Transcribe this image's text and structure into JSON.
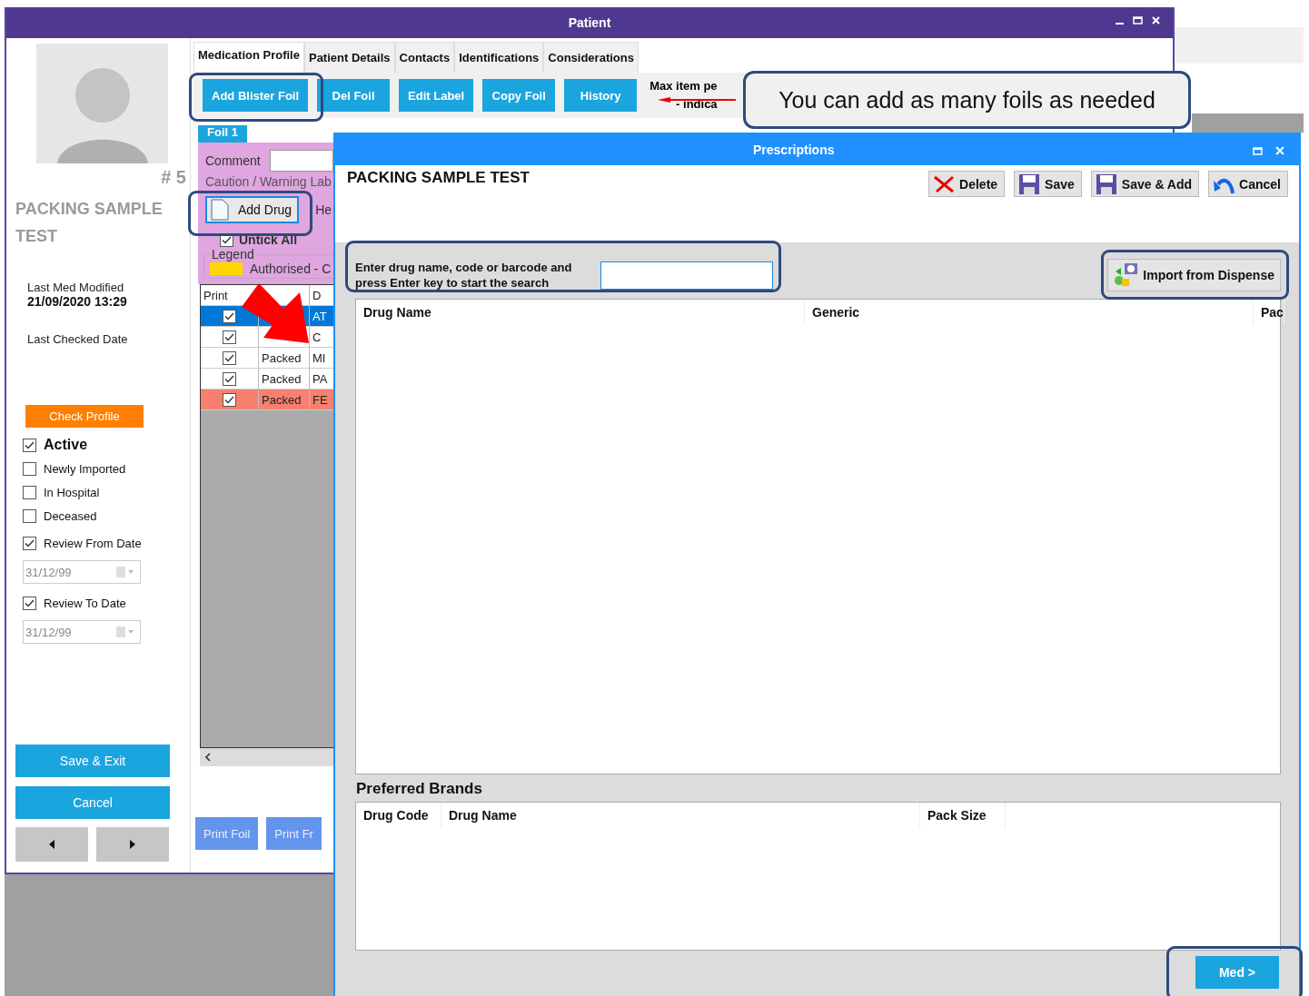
{
  "patient_window": {
    "title": "Patient",
    "profile": {
      "number": "# 5",
      "name": "PACKING SAMPLE TEST",
      "last_med_modified_label": "Last Med Modified",
      "last_med_modified": "21/09/2020 13:29",
      "last_checked_label": "Last Checked Date",
      "check_profile": "Check Profile",
      "flags": [
        {
          "label": "Active",
          "checked": true,
          "emphasis": true
        },
        {
          "label": "Newly Imported",
          "checked": false,
          "emphasis": false
        },
        {
          "label": "In Hospital",
          "checked": false,
          "emphasis": false
        },
        {
          "label": "Deceased",
          "checked": false,
          "emphasis": false
        },
        {
          "label": "Review From Date",
          "checked": true,
          "emphasis": false,
          "date": "31/12/99"
        },
        {
          "label": "Review To Date",
          "checked": true,
          "emphasis": false,
          "date": "31/12/99"
        }
      ],
      "save_exit": "Save & Exit",
      "cancel": "Cancel"
    },
    "tabs": [
      {
        "label": "Medication Profile",
        "selected": true
      },
      {
        "label": "Patient Details",
        "selected": false
      },
      {
        "label": "Contacts",
        "selected": false
      },
      {
        "label": "Identifications",
        "selected": false
      },
      {
        "label": "Considerations",
        "selected": false
      }
    ],
    "toolbar": [
      "Add Blister Foil",
      "Del Foil",
      "Edit Label",
      "Copy Foil",
      "History"
    ],
    "max_item_note": [
      "Max item pe",
      "- indica"
    ],
    "foil": {
      "tab": "Foil 1",
      "comment_label": "Comment",
      "caution_label": "Caution / Warning Lab",
      "add_drug": "Add Drug",
      "he_label": "He",
      "untick": {
        "label": "Untick All",
        "checked": true
      },
      "legend": {
        "title": "Legend",
        "items": [
          {
            "label": "Authorised - C",
            "color": "#ffd700"
          }
        ]
      },
      "table": {
        "header_print": "Print",
        "header_drug": "D",
        "rows": [
          {
            "print": true,
            "drug": "AT",
            "selected": true,
            "flagged": false
          },
          {
            "print": true,
            "drug": "C",
            "selected": false,
            "flagged": false
          },
          {
            "print": true,
            "status": "Packed",
            "drug": "MI",
            "selected": false,
            "flagged": false
          },
          {
            "print": true,
            "status": "Packed",
            "drug": "PA",
            "selected": false,
            "flagged": false
          },
          {
            "print": true,
            "status": "Packed",
            "drug": "FE",
            "selected": false,
            "flagged": true
          }
        ]
      }
    },
    "print_buttons": [
      "Print Foil",
      "Print Fr"
    ]
  },
  "dialog": {
    "title": "Prescriptions",
    "heading": "PACKING SAMPLE TEST",
    "actions": [
      {
        "label": "Delete",
        "kind": "delete"
      },
      {
        "label": "Save",
        "kind": "save"
      },
      {
        "label": "Save & Add",
        "kind": "save"
      },
      {
        "label": "Cancel",
        "kind": "undo"
      }
    ],
    "search_label": "Enter drug name, code or barcode and press Enter key to start the search",
    "import_button": "Import from Dispense",
    "drug_columns": [
      "Drug Name",
      "Generic",
      "Pac"
    ],
    "preferred_title": "Preferred Brands",
    "preferred_columns": [
      "Drug Code",
      "Drug Name",
      "Pack Size"
    ],
    "next_button": "Med >"
  },
  "callout": "You can add as many foils as needed"
}
